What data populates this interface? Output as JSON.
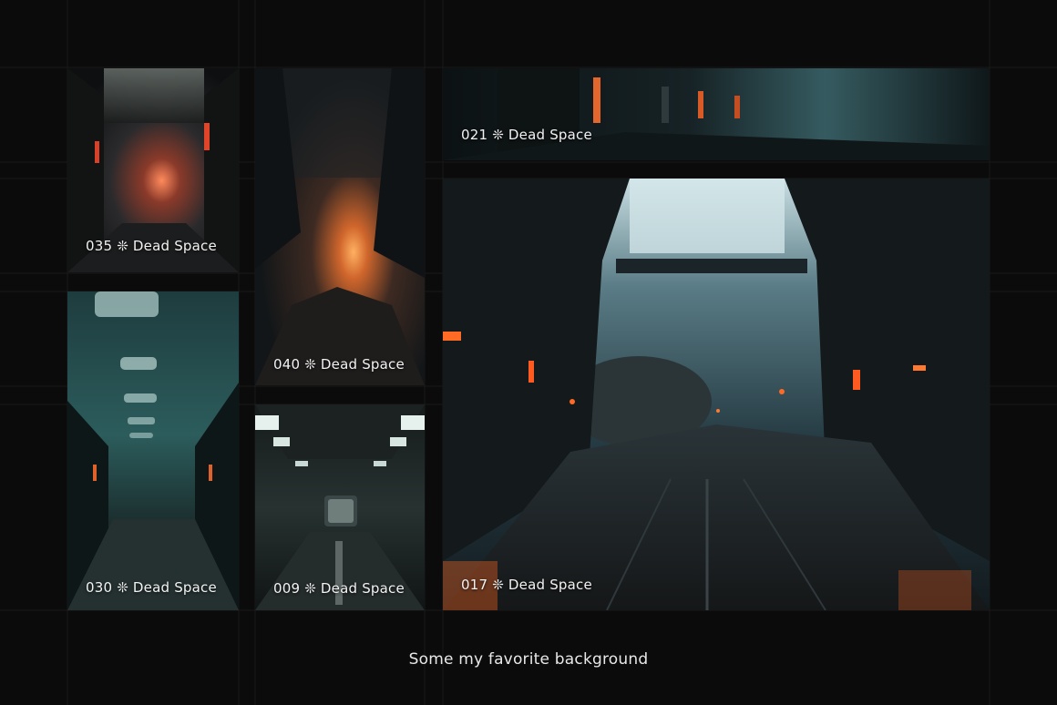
{
  "gallery": {
    "tiles": [
      {
        "caption": "035 ❊ Dead Space",
        "theme": "red-glow corridor"
      },
      {
        "caption": "040 ❊ Dead Space",
        "theme": "orange cavern"
      },
      {
        "caption": "021 ❊ Dead Space",
        "theme": "teal tunnel banner"
      },
      {
        "caption": "030 ❊ Dead Space",
        "theme": "teal ribbed corridor"
      },
      {
        "caption": "009 ❊ Dead Space",
        "theme": "lit steel hallway"
      },
      {
        "caption": "017 ❊ Dead Space",
        "theme": "wide hangar with orange lights"
      }
    ]
  },
  "footer": {
    "caption": "Some my favorite background"
  },
  "colors": {
    "background": "#0b0b0b",
    "accent_orange": "#ff5a1f",
    "accent_teal": "#2f6a6e"
  }
}
